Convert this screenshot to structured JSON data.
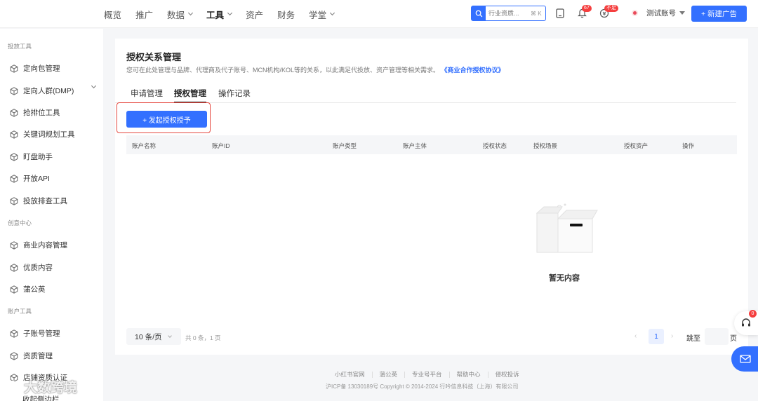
{
  "nav": {
    "items": [
      {
        "label": "概览",
        "has_caret": false,
        "active": false
      },
      {
        "label": "推广",
        "has_caret": false,
        "active": false
      },
      {
        "label": "数据",
        "has_caret": true,
        "active": false
      },
      {
        "label": "工具",
        "has_caret": true,
        "active": true
      },
      {
        "label": "资产",
        "has_caret": false,
        "active": false
      },
      {
        "label": "财务",
        "has_caret": false,
        "active": false
      },
      {
        "label": "学堂",
        "has_caret": true,
        "active": false
      }
    ],
    "search_placeholder": "行业资质...",
    "search_shortcut": "⌘ K",
    "notification_badge": "67",
    "status_badge": "不足",
    "account_name": "测试账号",
    "new_ad_label": "+ 新建广告"
  },
  "sidebar": {
    "sections": [
      {
        "title": "投放工具",
        "items": [
          "定向包管理",
          "定向人群(DMP)",
          "抢排位工具",
          "关键词规划工具",
          "盯盘助手",
          "开放API",
          "投放排查工具"
        ]
      },
      {
        "title": "创意中心",
        "items": [
          "商业内容管理",
          "优质内容",
          "蒲公英"
        ]
      },
      {
        "title": "账户工具",
        "items": [
          "子账号管理",
          "资质管理",
          "店铺资质认证"
        ]
      }
    ],
    "collapse_label": "收起侧边栏"
  },
  "main": {
    "title": "授权关系管理",
    "description": "您可在此处管理与品牌、代理商及代子账号、MCN机构/KOL等的关系，以此满足代投放、资产管理等相关需求。",
    "agreement_link": "《商业合作授权协议》",
    "tabs": [
      "申请管理",
      "授权管理",
      "操作记录"
    ],
    "active_tab": 1,
    "primary_button": "+ 发起授权授予",
    "table_headers": [
      "账户名称",
      "账户ID",
      "账户类型",
      "账户主体",
      "授权状态",
      "授权场景",
      "授权资产",
      "操作"
    ],
    "empty_text": "暂无内容",
    "pagination": {
      "page_size": "10 条/页",
      "total": "共 0 条，1 页",
      "current_page": "1",
      "jump_label": "跳至",
      "page_label": "页"
    }
  },
  "footer": {
    "links": [
      "小红书官网",
      "蒲公英",
      "专业号平台",
      "帮助中心",
      "侵权投诉"
    ],
    "copyright": "沪ICP备 13030189号 Copyright © 2014-2024 行吟信息科技（上海）有限公司"
  },
  "float": {
    "help_badge": "0"
  },
  "watermark": "大数跨境",
  "colors": {
    "accent": "#3370ff",
    "highlight_border": "#e5483f",
    "badge": "#f53f3f"
  }
}
